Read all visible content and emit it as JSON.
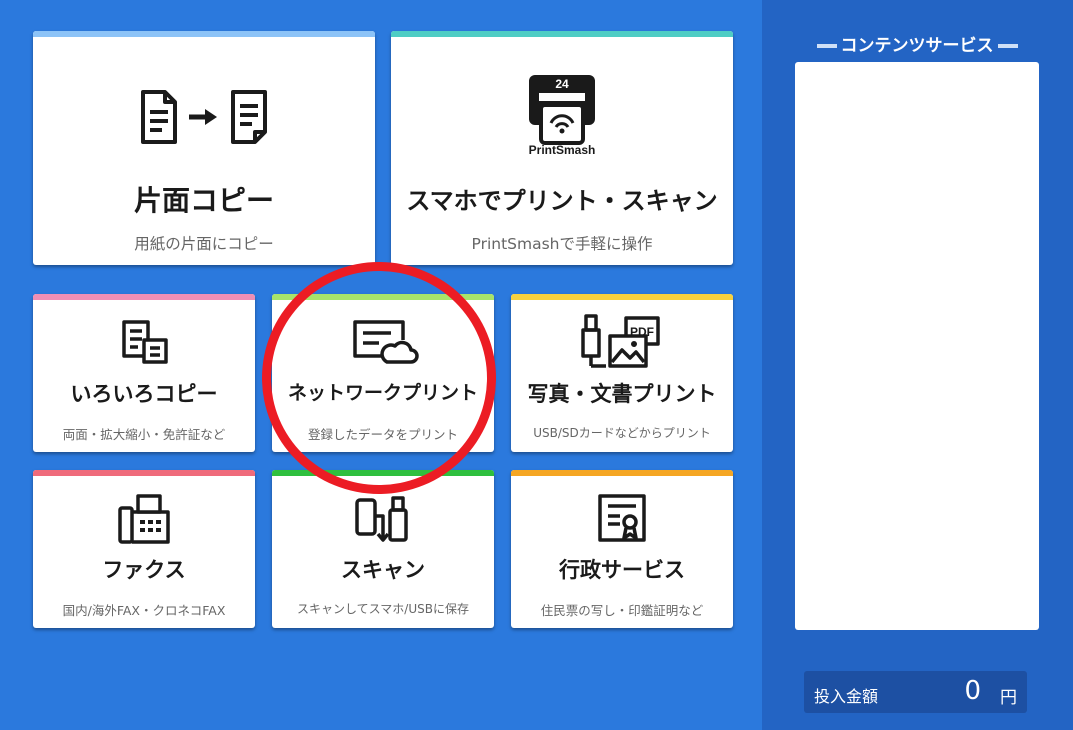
{
  "colors": {
    "background": "#2b79dd",
    "sidebar": "#2364c4",
    "annotation_circle": "#ec1c24"
  },
  "tiles": {
    "single_copy": {
      "title": "片面コピー",
      "subtitle": "用紙の片面にコピー",
      "bar_color": "#8cc3f7",
      "icon": "document-to-document-icon"
    },
    "smartphone_print": {
      "title": "スマホでプリント・スキャン",
      "subtitle": "PrintSmashで手軽に操作",
      "bar_color": "#4ecdc4",
      "icon": "printsmash-icon",
      "icon_badge": "24",
      "icon_text": "PrintSmash"
    },
    "various_copy": {
      "title": "いろいろコピー",
      "subtitle": "両面・拡大縮小・免許証など",
      "bar_color": "#ef8fb5",
      "icon": "multi-copy-icon"
    },
    "network_print": {
      "title": "ネットワークプリント",
      "subtitle": "登録したデータをプリント",
      "bar_color": "#a8e46a",
      "icon": "cloud-document-icon"
    },
    "photo_print": {
      "title": "写真・文書プリント",
      "subtitle": "USB/SDカードなどからプリント",
      "bar_color": "#f7d13e",
      "icon": "usb-pdf-photo-icon",
      "icon_text": "PDF"
    },
    "fax": {
      "title": "ファクス",
      "subtitle": "国内/海外FAX・クロネコFAX",
      "bar_color": "#ef6b7b",
      "icon": "fax-icon"
    },
    "scan": {
      "title": "スキャン",
      "subtitle": "スキャンしてスマホ/USBに保存",
      "bar_color": "#2fbf3e",
      "icon": "scan-to-device-icon"
    },
    "government": {
      "title": "行政サービス",
      "subtitle": "住民票の写し・印鑑証明など",
      "bar_color": "#f5a623",
      "icon": "certificate-icon"
    }
  },
  "sidebar": {
    "title": "コンテンツサービス"
  },
  "money": {
    "label": "投入金額",
    "value": "0",
    "unit": "円"
  }
}
